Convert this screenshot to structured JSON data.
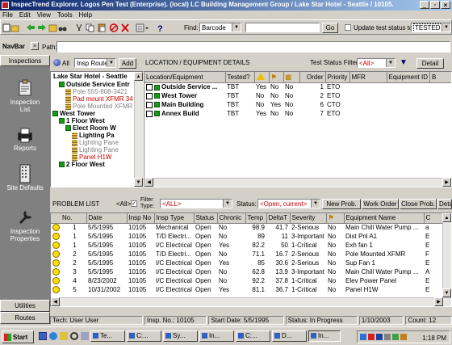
{
  "window": {
    "title": "InspecTrend Explorer. Logos Pen Test (Enterprise). (local) LC Building Management Group / Lake Star Hotel - Seattle / 10105.",
    "controls": [
      "_",
      "▫",
      "×"
    ]
  },
  "menu": [
    "File",
    "Edit",
    "View",
    "Tools",
    "Help"
  ],
  "toolbar": {
    "find_label": "Find:",
    "find_value": "Barcode",
    "go": "Go",
    "update_label": "Update test status to",
    "update_value": "TESTED"
  },
  "navbar": {
    "title": "NavBar",
    "path_label": "Path:",
    "path_value": ""
  },
  "sidebar": {
    "inspections": "Inspections",
    "items": [
      {
        "label": "Inspection List",
        "icon": "clipboard-icon"
      },
      {
        "label": "Reports",
        "icon": "printer-icon"
      },
      {
        "label": "Site Defaults",
        "icon": "building-icon"
      },
      {
        "label": "Inspection Properties",
        "icon": "wrench-icon"
      }
    ],
    "utilities": "Utilities",
    "routes": "Routes"
  },
  "filter": {
    "all": "All",
    "route_value": "Insp Route",
    "add": "Add"
  },
  "tree": {
    "root": "Lake Star Hotel - Seattle",
    "items": [
      {
        "text": "Outside Service Entr",
        "bold": true,
        "indent": 1,
        "icon": "green"
      },
      {
        "text": "Pole 555-808-3421",
        "indent": 2,
        "color": "gray",
        "icon": "xfmr"
      },
      {
        "text": "Pad mount XFMR 34",
        "indent": 2,
        "color": "red",
        "icon": "xfmr"
      },
      {
        "text": "Pole Mounted XFMR",
        "indent": 2,
        "color": "gray",
        "icon": "xfmr"
      },
      {
        "text": "West Tower",
        "bold": true,
        "indent": 0,
        "icon": "green"
      },
      {
        "text": "1 Floor West",
        "bold": true,
        "indent": 1,
        "icon": "green"
      },
      {
        "text": "Elect Room W",
        "bold": true,
        "indent": 2,
        "icon": "green"
      },
      {
        "text": "Lighting Pa",
        "bold": true,
        "indent": 3,
        "icon": "xfmr"
      },
      {
        "text": "Lighting Pane",
        "indent": 3,
        "color": "gray",
        "icon": "xfmr"
      },
      {
        "text": "Lighting Pane",
        "indent": 3,
        "color": "gray",
        "icon": "xfmr"
      },
      {
        "text": "Panel H1W",
        "indent": 3,
        "color": "red",
        "icon": "xfmr"
      },
      {
        "text": "2 Floor West",
        "bold": true,
        "indent": 1,
        "icon": "green"
      }
    ]
  },
  "location": {
    "title": "LOCATION / EQUIPMENT DETAILS",
    "filter_label": "Test Status Filter",
    "filter_value": "<All>",
    "detail": "Detail",
    "columns": [
      "Location/Equipment",
      "Tested?",
      "",
      "",
      "",
      "Order",
      "Priority",
      "MFR",
      "Equipment ID",
      "B"
    ],
    "rows": [
      {
        "name": "Outside Service ...",
        "tested": "TBT",
        "a": "Yes",
        "b": "No",
        "c": "No",
        "order": "1",
        "priority": "ETO"
      },
      {
        "name": "West Tower",
        "tested": "TBT",
        "a": "No",
        "b": "No",
        "c": "No",
        "order": "2",
        "priority": "ETO"
      },
      {
        "name": "Main Building",
        "tested": "TBT",
        "a": "No",
        "b": "Yes",
        "c": "No",
        "order": "6",
        "priority": "CTO"
      },
      {
        "name": "Annex Build",
        "tested": "TBT",
        "a": "Yes",
        "b": "No",
        "c": "No",
        "order": "7",
        "priority": "ETO"
      }
    ]
  },
  "problems": {
    "title": "PROBLEM LIST",
    "all_label": "<All>",
    "filter_type_label": "Filter Type:",
    "filter_type_value": "<ALL>",
    "status_label": "Status:",
    "status_value": "<Open, current>",
    "new": "New Prob.",
    "work_order": "Work Order",
    "close": "Close Prob.",
    "detail": "Detail",
    "columns": [
      "No.",
      "Date",
      "Insp No",
      "Insp Type",
      "Status",
      "Chronic",
      "Temp",
      "DeltaT",
      "Severity",
      "",
      "Equipment Name",
      "C"
    ],
    "rows": [
      [
        "1",
        "5/5/1995",
        "10105",
        "Mechanical",
        "Open",
        "No",
        "98.9",
        "41.7",
        "2-Serious",
        "No",
        "Main Chill Water Pump ...",
        "a"
      ],
      [
        "1",
        "5/5/1995",
        "10105",
        "T/D Electri...",
        "Open",
        "No",
        "89",
        "11",
        "3-Important",
        "No",
        "Dist Pnl A1",
        "E"
      ],
      [
        "1",
        "5/5/1995",
        "10105",
        "I/C Electrical",
        "Open",
        "Yes",
        "82.2",
        "50",
        "1-Critical",
        "No",
        "Exh fan 1",
        "E"
      ],
      [
        "2",
        "5/5/1995",
        "10105",
        "T/D Electri...",
        "Open",
        "No",
        "71.1",
        "16.7",
        "2-Serious",
        "No",
        "Pole Mounted XFMR",
        "F"
      ],
      [
        "2",
        "5/5/1995",
        "10105",
        "I/C Electrical",
        "Open",
        "Yes",
        "85",
        "30.6",
        "2-Serious",
        "No",
        "Sup Fan 1",
        "E"
      ],
      [
        "3",
        "5/5/1995",
        "10105",
        "I/C Electrical",
        "Open",
        "No",
        "62.8",
        "13.9",
        "3-Important",
        "No",
        "Main Chill Water Pump ...",
        "A"
      ],
      [
        "4",
        "8/23/2002",
        "10105",
        "I/C Electrical",
        "Open",
        "No",
        "92.2",
        "37.8",
        "1-Critical",
        "No",
        "Elev Power Panel",
        "E"
      ],
      [
        "5",
        "10/31/2002",
        "10105",
        "I/C Electrical",
        "Open",
        "Yes",
        "81.1",
        "36.7",
        "1-Critical",
        "No",
        "Panel H1W",
        "E"
      ]
    ]
  },
  "status": {
    "user": "Tech: User User",
    "insp": "Insp. No.: 10105",
    "start": "Start Date: 5/5/1995",
    "state": "Status: In Progress",
    "date": "1/10/2003",
    "count": "Count: 12"
  },
  "taskbar": {
    "start": "Start",
    "tasks": [
      "Te...",
      "C:...",
      "Sy...",
      "In...",
      "C:...",
      "D...",
      "In..."
    ],
    "clock": "1:18 PM"
  }
}
